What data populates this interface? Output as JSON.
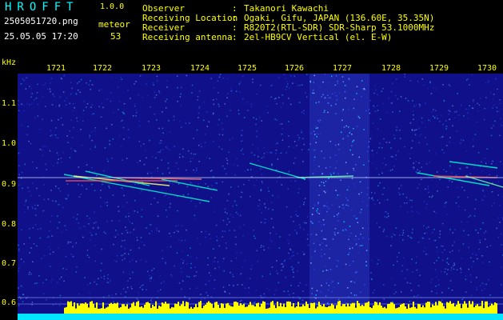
{
  "header": {
    "app_title": "HROFFT",
    "version": "1.0.0",
    "filename": "2505051720.png",
    "datetime": "25.05.05 17:20",
    "meteor_label": "meteor",
    "meteor_count": "53"
  },
  "info": [
    {
      "key": "Observer",
      "value": "Takanori Kawachi"
    },
    {
      "key": "Receiving Location",
      "value": "Ogaki, Gifu, JAPAN (136.60E, 35.35N)"
    },
    {
      "key": "Receiver",
      "value": "R820T2(RTL-SDR) SDR-Sharp 53.1000MHz"
    },
    {
      "key": "Receiving antenna",
      "value": "2el-HB9CV Vertical (el. E-W)"
    }
  ],
  "info_separator": ":",
  "axes": {
    "y_unit": "kHz",
    "x_ticks": [
      "1721",
      "1722",
      "1723",
      "1724",
      "1725",
      "1726",
      "1727",
      "1728",
      "1729",
      "1730"
    ],
    "y_ticks": [
      "1.1",
      "1.0",
      "0.9",
      "0.8",
      "0.7",
      "0.6"
    ]
  },
  "colors": {
    "background": "#000000",
    "header_text": "#ffff00",
    "title": "#00ffff",
    "plot_bg": "#10108a",
    "noise": "#3a6cff",
    "trace": "#00ffcc",
    "trace_hot": "#ff4040",
    "spectrum": "#ffff00",
    "baseline": "#00e5ff"
  }
}
